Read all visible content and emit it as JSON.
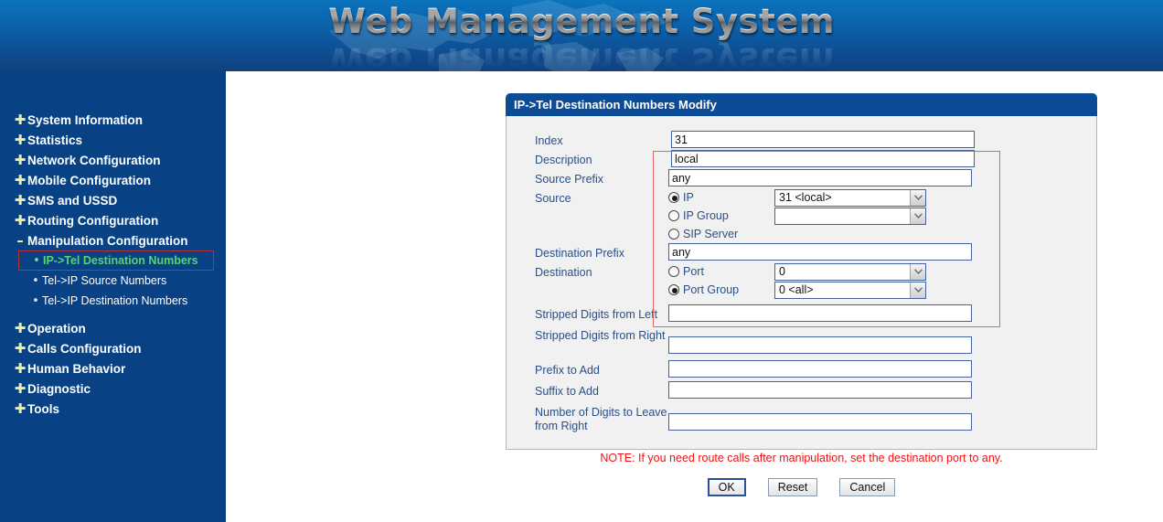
{
  "header": {
    "title": "Web Management System",
    "map_icon": "world-map-watermark"
  },
  "sidebar": {
    "items": [
      {
        "label": "System Information",
        "icon": "plus-icon",
        "expanded": false
      },
      {
        "label": "Statistics",
        "icon": "plus-icon",
        "expanded": false
      },
      {
        "label": "Network Configuration",
        "icon": "plus-icon",
        "expanded": false
      },
      {
        "label": "Mobile Configuration",
        "icon": "plus-icon",
        "expanded": false
      },
      {
        "label": "SMS and USSD",
        "icon": "plus-icon",
        "expanded": false
      },
      {
        "label": "Routing Configuration",
        "icon": "plus-icon",
        "expanded": false
      },
      {
        "label": "Manipulation Configuration",
        "icon": "minus-icon",
        "expanded": true
      },
      {
        "label": "Operation",
        "icon": "plus-icon",
        "expanded": false
      },
      {
        "label": "Calls Configuration",
        "icon": "plus-icon",
        "expanded": false
      },
      {
        "label": "Human Behavior",
        "icon": "plus-icon",
        "expanded": false
      },
      {
        "label": "Diagnostic",
        "icon": "plus-icon",
        "expanded": false
      },
      {
        "label": "Tools",
        "icon": "plus-icon",
        "expanded": false
      }
    ],
    "submenu": [
      {
        "label": "IP->Tel Destination Numbers",
        "selected": true
      },
      {
        "label": "Tel->IP Source Numbers",
        "selected": false
      },
      {
        "label": "Tel->IP Destination Numbers",
        "selected": false
      }
    ],
    "selected_highlight_color": "#b3323c",
    "selected_text_color": "#58d46e"
  },
  "panel": {
    "title": "IP->Tel Destination Numbers Modify",
    "header_color": "#0c4b96",
    "highlight_box_color": "#e06666",
    "fields": {
      "index": {
        "label": "Index",
        "value": "31",
        "placeholder": ""
      },
      "description": {
        "label": "Description",
        "value": "local",
        "placeholder": ""
      },
      "source_prefix": {
        "label": "Source Prefix",
        "value": "any",
        "placeholder": ""
      },
      "source": {
        "label": "Source",
        "options": [
          {
            "label": "IP",
            "selected": true,
            "select_value": "31  <local>"
          },
          {
            "label": "IP Group",
            "selected": false,
            "select_value": ""
          },
          {
            "label": "SIP Server",
            "selected": false,
            "select_value": null
          }
        ]
      },
      "destination_prefix": {
        "label": "Destination Prefix",
        "value": "any",
        "placeholder": ""
      },
      "destination": {
        "label": "Destination",
        "options": [
          {
            "label": "Port",
            "selected": false,
            "select_value": "0"
          },
          {
            "label": "Port Group",
            "selected": true,
            "select_value": "0  <all>"
          }
        ]
      },
      "stripped_left": {
        "label": "Stripped Digits from Left",
        "value": "",
        "placeholder": ""
      },
      "stripped_right": {
        "label": "Stripped Digits from Right",
        "value": "",
        "placeholder": ""
      },
      "prefix_to_add": {
        "label": "Prefix to Add",
        "value": "",
        "placeholder": ""
      },
      "suffix_to_add": {
        "label": "Suffix to Add",
        "value": "",
        "placeholder": ""
      },
      "digits_leave_right": {
        "label": "Number of Digits to Leave from Right",
        "value": "",
        "placeholder": ""
      }
    }
  },
  "note": {
    "text": "NOTE: If you need route calls after manipulation, set the destination port to any.",
    "color": "#ee1111"
  },
  "buttons": {
    "ok": "OK",
    "reset": "Reset",
    "cancel": "Cancel"
  }
}
